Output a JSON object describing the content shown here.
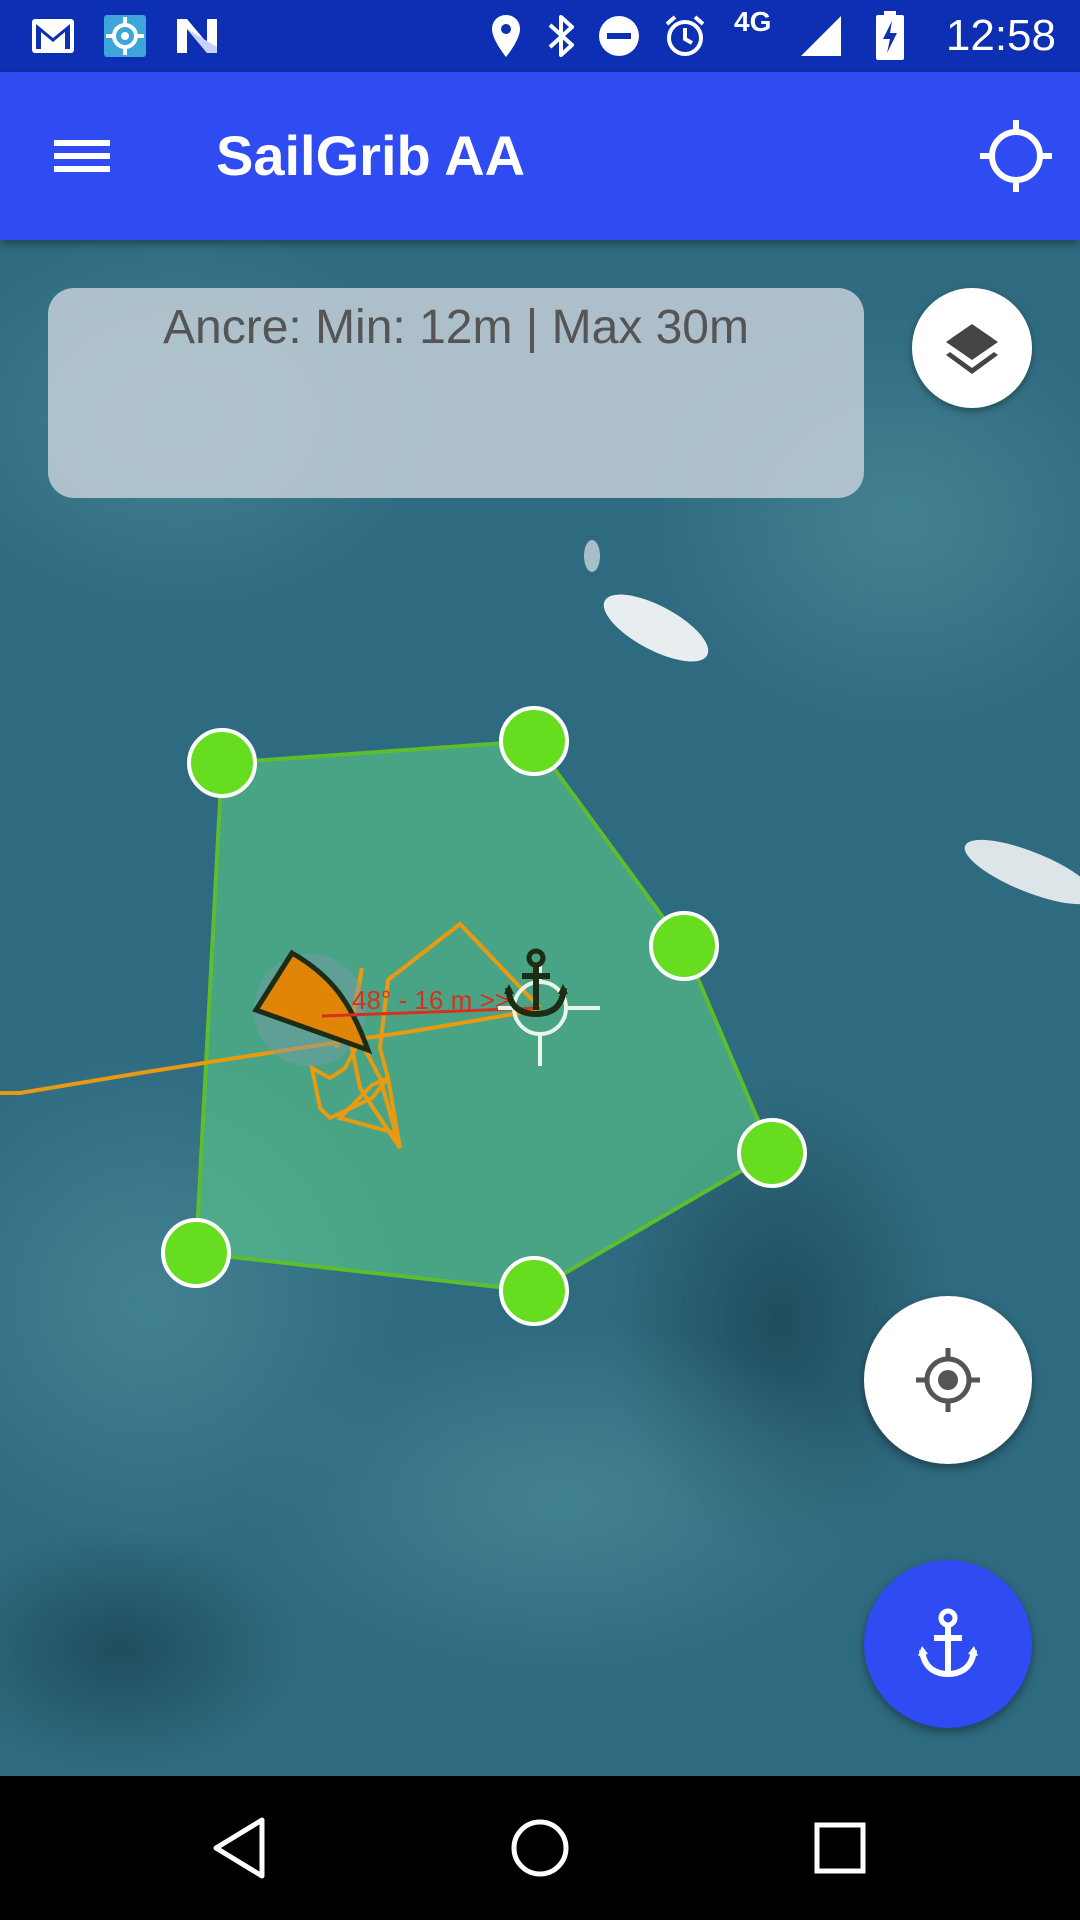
{
  "status_bar": {
    "time": "12:58",
    "network": "4G",
    "left_icons": [
      "gmail-icon",
      "target-app-icon",
      "n-app-icon"
    ],
    "right_icons": [
      "location-icon",
      "bluetooth-icon",
      "do-not-disturb-icon",
      "alarm-icon",
      "signal-icon",
      "battery-charging-icon"
    ]
  },
  "app_bar": {
    "title": "SailGrib AA",
    "menu_icon": "menu-icon",
    "action_icon": "gps-target-icon"
  },
  "info_panel": {
    "text": "Ancre: Min: 12m | Max 30m"
  },
  "map": {
    "bearing_label": "48° - 16 m >>",
    "colors": {
      "zone_fill": "#5fd38a",
      "zone_stroke": "#5cbd2e",
      "vertex_fill": "#66dd1f",
      "track": "#e89a10",
      "boat": "#e08508",
      "bearing_line": "#d8301c",
      "anchor": "#1c2d14"
    }
  },
  "buttons": {
    "layers": "layers-icon",
    "locate": "my-location-icon",
    "anchor": "anchor-icon"
  },
  "nav_bar": {
    "icons": [
      "back-icon",
      "home-icon",
      "recents-icon"
    ]
  },
  "colors": {
    "status_bar": "#0c2fb3",
    "app_bar": "#2f4bf2",
    "fab_primary": "#2f4bf2"
  }
}
